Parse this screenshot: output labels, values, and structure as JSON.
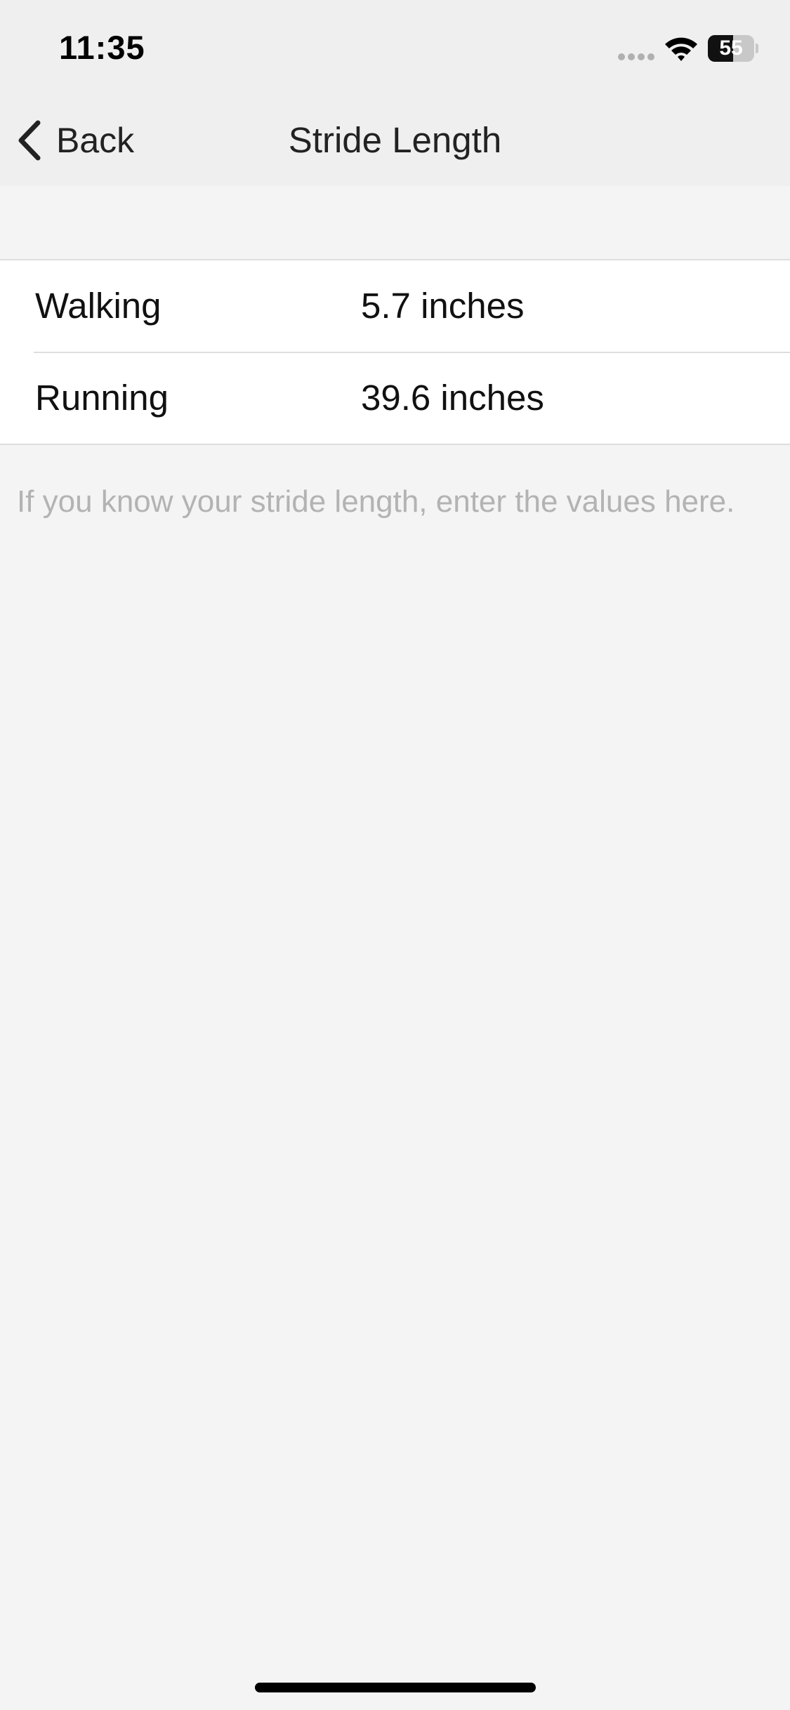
{
  "status_bar": {
    "time": "11:35",
    "battery_level": "55",
    "battery_fraction": 0.55,
    "icons": [
      "cellular-signal-icon",
      "wifi-icon",
      "battery-icon"
    ]
  },
  "nav": {
    "back_label": "Back",
    "title": "Stride Length"
  },
  "stride": {
    "rows": [
      {
        "label": "Walking",
        "value": "5.7 inches"
      },
      {
        "label": "Running",
        "value": "39.6 inches"
      }
    ],
    "footer": "If you know your stride length, enter the values here."
  },
  "colors": {
    "bar_background": "#eeefee",
    "page_background": "#f4f4f4",
    "footer_text": "#b3b3b3"
  }
}
